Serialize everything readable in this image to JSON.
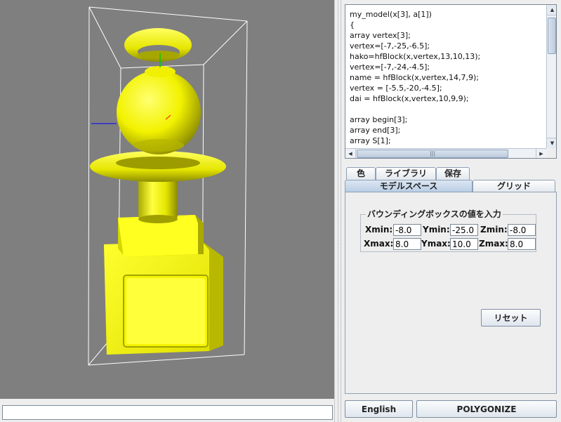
{
  "code_lines": [
    "my_model(x[3], a[1])",
    "{",
    "array vertex[3];",
    "vertex=[-7,-25,-6.5];",
    "hako=hfBlock(x,vertex,13,10,13);",
    "vertex=[-7,-24,-4.5];",
    "name = hfBlock(x,vertex,14,7,9);",
    "vertex = [-5.5,-20,-4.5];",
    "dai = hfBlock(x,vertex,10,9,9);",
    "",
    "array begin[3];",
    "array end[3];",
    "array S[1];"
  ],
  "tabs_top": {
    "color": "色",
    "library": "ライブラリ",
    "save": "保存"
  },
  "tabs_main": {
    "model_space": "モデルスペース",
    "grid": "グリッド"
  },
  "bbox": {
    "legend": "バウンディングボックスの値を入力",
    "xmin_label": "Xmin:",
    "ymin_label": "Ymin:",
    "zmin_label": "Zmin:",
    "xmax_label": "Xmax:",
    "ymax_label": "Ymax:",
    "zmax_label": "Zmax:",
    "xmin": "-8.0",
    "ymin": "-25.0",
    "zmin": "-8.0",
    "xmax": "8.0",
    "ymax": "10.0",
    "zmax": "8.0"
  },
  "buttons": {
    "reset": "リセット",
    "english": "English",
    "polygonize": "POLYGONIZE"
  },
  "command_input": {
    "value": ""
  },
  "colors": {
    "model": "#ffff00",
    "model_shadow": "#8c8c00",
    "viewport_bg": "#7f7f7f",
    "bbox_lines": "#ffffff"
  }
}
